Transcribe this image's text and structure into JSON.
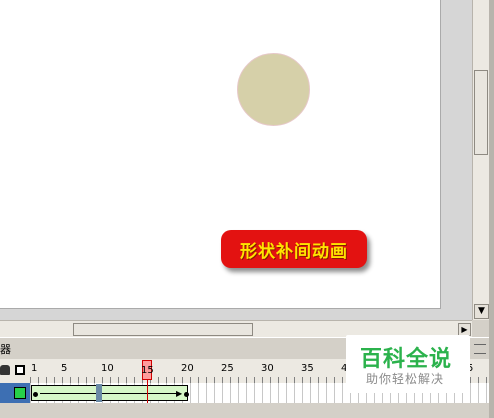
{
  "stage": {
    "badge_text": "形状补间动画",
    "colors": {
      "badge_bg": "#e31211",
      "badge_text": "#ffe400",
      "circle_fill": "#d6d0a9"
    }
  },
  "timeline": {
    "panel_label": "器",
    "ruler_labels": [
      "1",
      "5",
      "10",
      "15",
      "20",
      "25",
      "30",
      "35",
      "4",
      "5"
    ],
    "current_frame": "15",
    "tween_color": "#d6f7c8",
    "layer_color": "#27d04a"
  },
  "icons": [
    "lock-icon",
    "outline-icon",
    "chevron-right-icon",
    "chevron-down-icon"
  ],
  "watermark": {
    "title": "百科全说",
    "subtitle": "助你轻松解决"
  }
}
